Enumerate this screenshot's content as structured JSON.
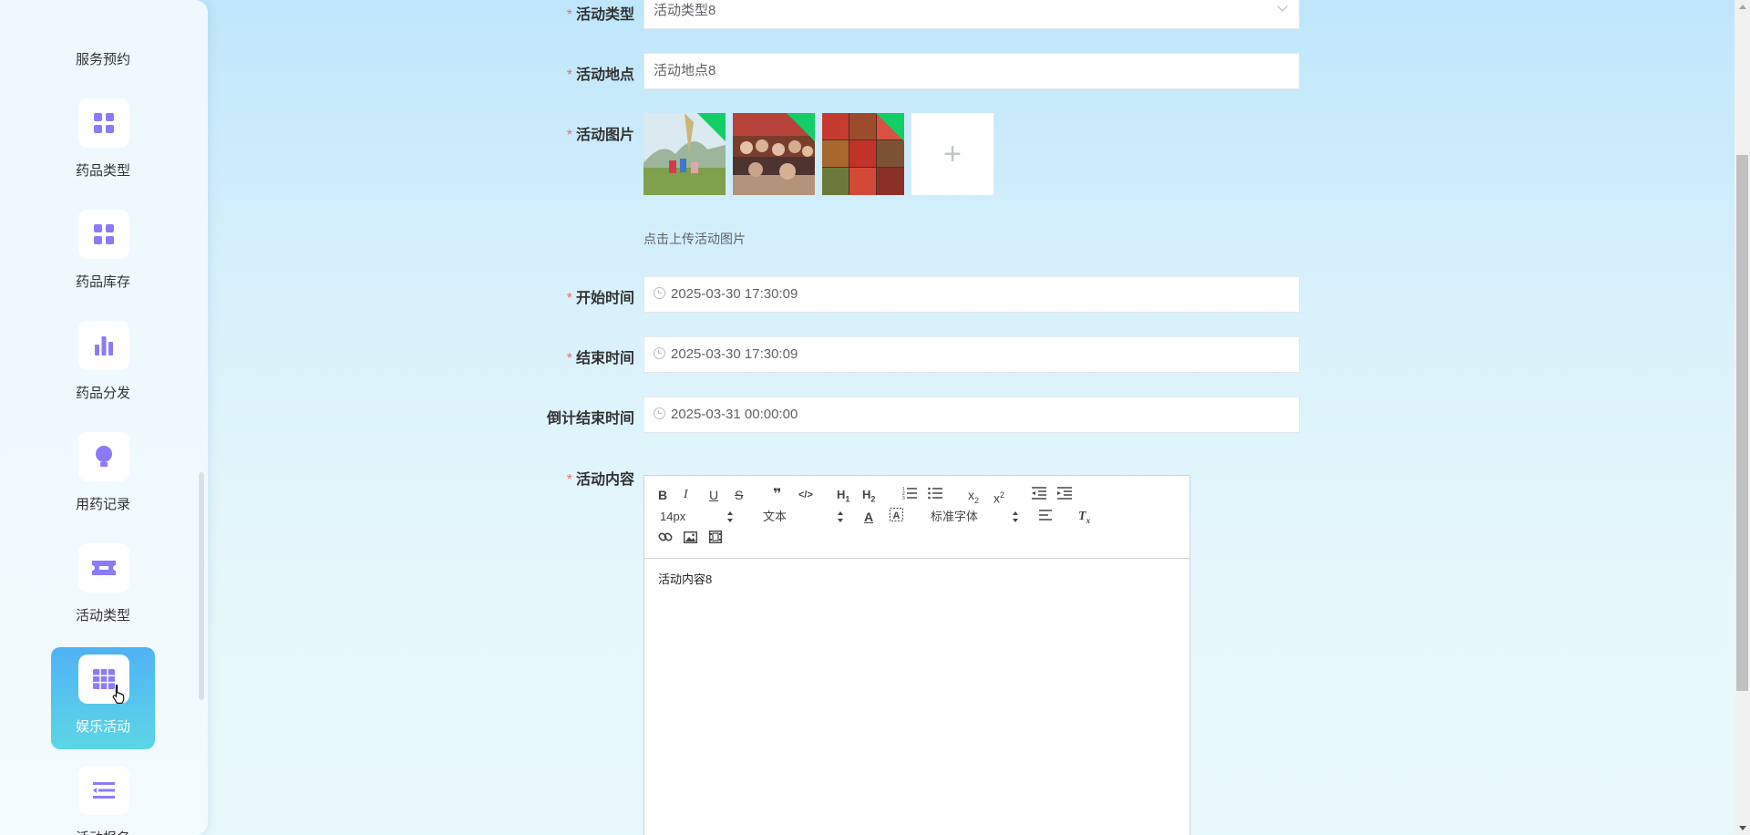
{
  "sidebar": {
    "top_label": "服务预约",
    "items": [
      {
        "label": "药品类型",
        "icon": "grid-icon"
      },
      {
        "label": "药品库存",
        "icon": "grid-icon"
      },
      {
        "label": "药品分发",
        "icon": "bar-chart-icon"
      },
      {
        "label": "用药记录",
        "icon": "bulb-icon"
      },
      {
        "label": "活动类型",
        "icon": "ticket-icon"
      },
      {
        "label": "娱乐活动",
        "icon": "table-icon",
        "active": true
      },
      {
        "label": "活动报名",
        "icon": "list-icon"
      }
    ],
    "accent_color": "#8a7cf6",
    "active_gradient": [
      "#4fb2f5",
      "#5dd6e6"
    ]
  },
  "form": {
    "activity_type": {
      "label": "活动类型",
      "value": "活动类型8"
    },
    "activity_location": {
      "label": "活动地点",
      "value": "活动地点8"
    },
    "activity_images": {
      "label": "活动图片",
      "hint": "点击上传活动图片",
      "upload_icon": "+"
    },
    "start_time": {
      "label": "开始时间",
      "value": "2025-03-30 17:30:09"
    },
    "end_time": {
      "label": "结束时间",
      "value": "2025-03-30 17:30:09"
    },
    "countdown_end": {
      "label": "倒计结束时间",
      "value": "2025-03-31 00:00:00"
    },
    "content": {
      "label": "活动内容",
      "value": "活动内容8"
    },
    "required_mark": "*"
  },
  "editor_toolbar": {
    "font_size": "14px",
    "header": "文本",
    "font_family": "标准字体"
  }
}
